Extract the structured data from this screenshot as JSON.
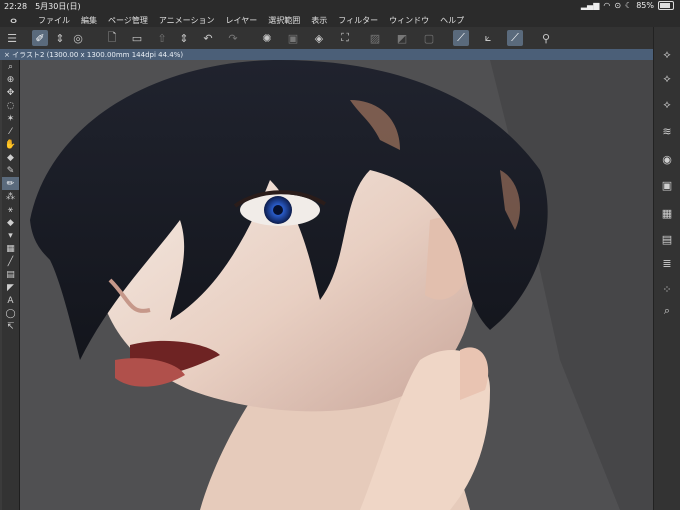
{
  "status": {
    "time": "22:28",
    "date": "5月30日(日)",
    "battery": "85%"
  },
  "menu": {
    "items": [
      "ファイル",
      "編集",
      "ページ管理",
      "アニメーション",
      "レイヤー",
      "選択範囲",
      "表示",
      "フィルター",
      "ウィンドウ",
      "ヘルプ"
    ]
  },
  "doc": {
    "tab": "× イラスト2 (1300.00 x 1300.00mm 144dpi 44.4%)"
  }
}
